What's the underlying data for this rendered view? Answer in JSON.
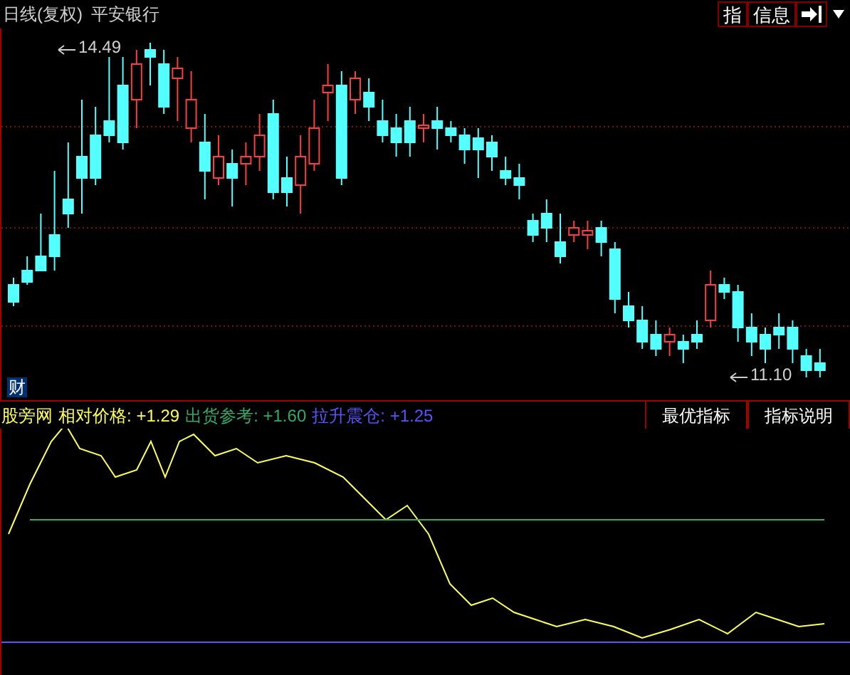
{
  "header": {
    "period": "日线(复权)",
    "stock": "平安银行",
    "buttons": [
      "指",
      "信息"
    ]
  },
  "main_chart": {
    "high_label": "14.49",
    "low_label": "11.10",
    "badge": "财"
  },
  "indicator": {
    "name": "股旁网",
    "items": [
      {
        "label": "相对价格:",
        "value": "+1.29",
        "color": "#ffff55"
      },
      {
        "label": "出货参考:",
        "value": "+1.60",
        "color": "#33aa66"
      },
      {
        "label": "拉升震仓:",
        "value": "+1.25",
        "color": "#5555ff"
      }
    ],
    "buttons": [
      "最优指标",
      "指标说明"
    ]
  }
}
